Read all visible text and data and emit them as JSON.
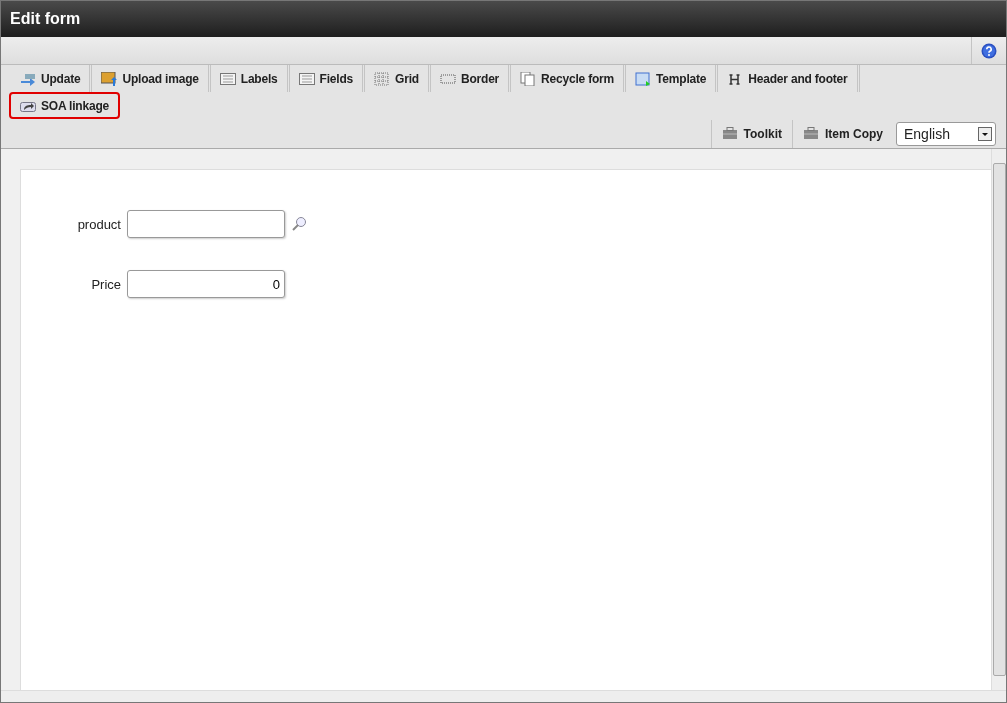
{
  "window": {
    "title": "Edit form"
  },
  "toolbar": [
    {
      "label": "Update",
      "kind": "update",
      "highlighted": false
    },
    {
      "label": "Upload image",
      "kind": "image",
      "highlighted": false
    },
    {
      "label": "Labels",
      "kind": "list",
      "highlighted": false
    },
    {
      "label": "Fields",
      "kind": "list",
      "highlighted": false
    },
    {
      "label": "Grid",
      "kind": "grid",
      "highlighted": false
    },
    {
      "label": "Border",
      "kind": "border",
      "highlighted": false
    },
    {
      "label": "Recycle form",
      "kind": "copy",
      "highlighted": false
    },
    {
      "label": "Template",
      "kind": "template",
      "highlighted": false
    },
    {
      "label": "Header and footer",
      "kind": "header",
      "highlighted": false
    },
    {
      "label": "SOA linkage",
      "kind": "share",
      "highlighted": true
    }
  ],
  "tools": [
    {
      "label": "Toolkit"
    },
    {
      "label": "Item Copy"
    }
  ],
  "language": {
    "value": "English"
  },
  "form": [
    {
      "label": "product",
      "kind": "lookup"
    },
    {
      "label": "Price",
      "value": "0",
      "kind": "number"
    }
  ]
}
